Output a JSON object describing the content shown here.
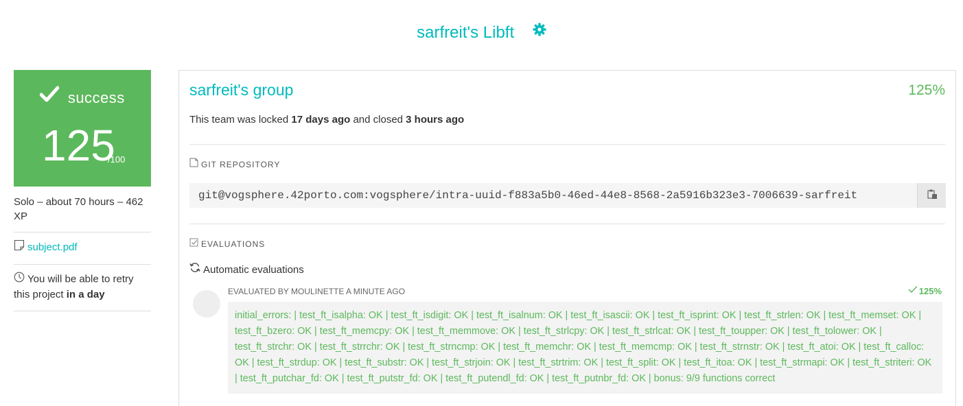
{
  "header": {
    "title": "sarfreit's Libft",
    "settings_icon": "gear-icon"
  },
  "result": {
    "status_icon": "checkmark-icon",
    "status": "success",
    "score": "125",
    "score_max": "/100"
  },
  "project_meta": "Solo – about 70 hours – 462 XP",
  "subject": {
    "icon": "document-icon",
    "label": "subject.pdf"
  },
  "retry": {
    "icon": "clock-icon",
    "prefix": "You will be able to retry this project ",
    "when": "in a day"
  },
  "team": {
    "name": "sarfreit's group",
    "percent": "125%",
    "locked_prefix": "This team was locked ",
    "locked_when": "17 days ago",
    "closed_prefix": " and closed ",
    "closed_when": "3 hours ago"
  },
  "git": {
    "label": "GIT REPOSITORY",
    "url": "git@vogsphere.42porto.com:vogsphere/intra-uuid-f883a5b0-46ed-44e8-8568-2a5916b323e3-7006639-sarfreit",
    "copy_icon": "clipboard-icon"
  },
  "evaluations": {
    "label": "EVALUATIONS",
    "automatic_label": "Automatic evaluations",
    "evaluator": "EVALUATED BY MOULINETTE A MINUTE AGO",
    "percent": "125%",
    "output": "initial_errors: | test_ft_isalpha: OK | test_ft_isdigit: OK | test_ft_isalnum: OK | test_ft_isascii: OK | test_ft_isprint: OK | test_ft_strlen: OK | test_ft_memset: OK | test_ft_bzero: OK | test_ft_memcpy: OK | test_ft_memmove: OK | test_ft_strlcpy: OK | test_ft_strlcat: OK | test_ft_toupper: OK | test_ft_tolower: OK | test_ft_strchr: OK | test_ft_strrchr: OK | test_ft_strncmp: OK | test_ft_memchr: OK | test_ft_memcmp: OK | test_ft_strnstr: OK | test_ft_atoi: OK | test_ft_calloc: OK | test_ft_strdup: OK | test_ft_substr: OK | test_ft_strjoin: OK | test_ft_strtrim: OK | test_ft_split: OK | test_ft_itoa: OK | test_ft_strmapi: OK | test_ft_striteri: OK | test_ft_putchar_fd: OK | test_ft_putstr_fd: OK | test_ft_putendl_fd: OK | test_ft_putnbr_fd: OK | bonus: 9/9 functions correct"
  },
  "colors": {
    "accent": "#00babc",
    "success": "#5cb85c"
  }
}
